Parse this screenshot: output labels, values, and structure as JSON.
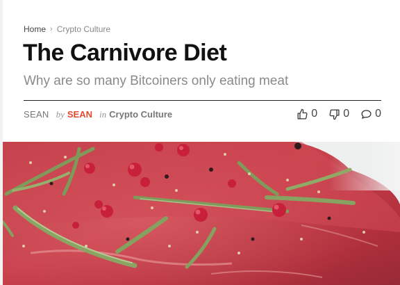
{
  "breadcrumb": {
    "home": "Home",
    "current": "Crypto Culture"
  },
  "article": {
    "title": "The Carnivore Diet",
    "subtitle": "Why are so many Bitcoiners only eating meat"
  },
  "meta": {
    "author_plain": "SEAN",
    "by_label": "by",
    "author_link": "SEAN",
    "in_label": "in",
    "category": "Crypto Culture"
  },
  "actions": {
    "likes": "0",
    "dislikes": "0",
    "comments": "0"
  },
  "hero": {
    "subject": "raw steak with rosemary and peppercorns"
  },
  "colors": {
    "accent": "#e2492f",
    "title": "#111111",
    "muted": "#8a8a8a"
  }
}
